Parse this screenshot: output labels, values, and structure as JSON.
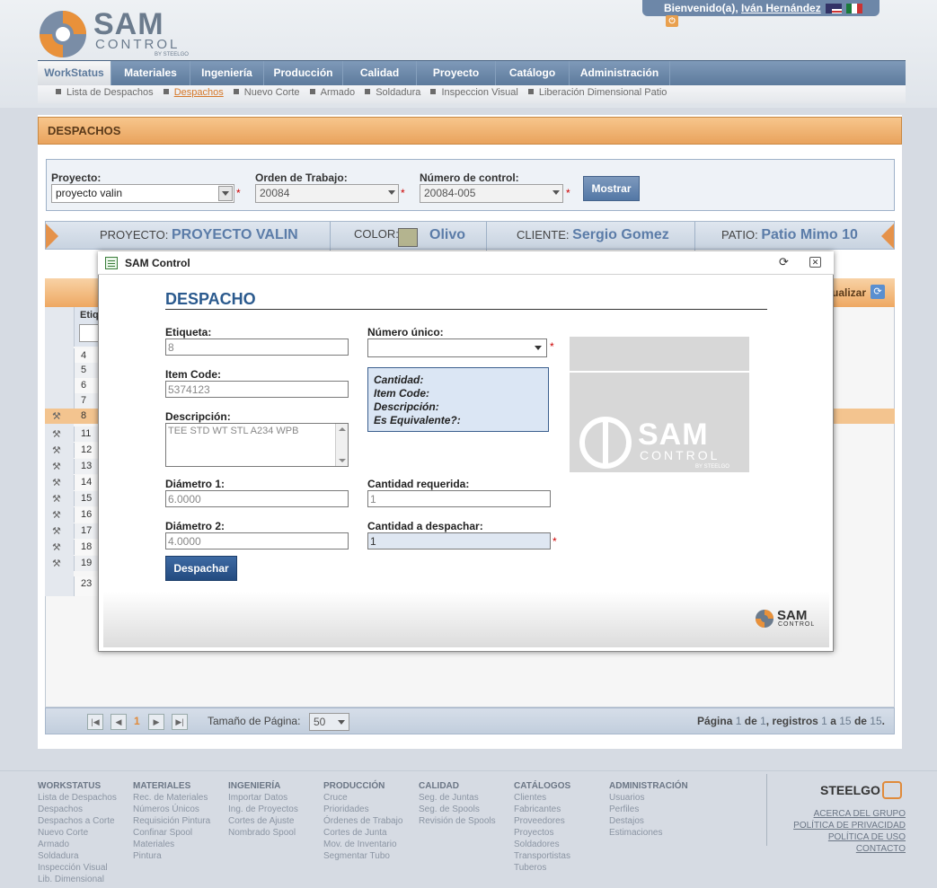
{
  "welcome": {
    "prefix": "Bienvenido(a),",
    "user": "Iván Hernández"
  },
  "logo": {
    "word": "SAM",
    "sub": "CONTROL",
    "by": "BY STEELGO"
  },
  "nav": [
    "WorkStatus",
    "Materiales",
    "Ingeniería",
    "Producción",
    "Calidad",
    "Proyecto",
    "Catálogo",
    "Administración"
  ],
  "subnav": [
    "Lista de Despachos",
    "Despachos",
    "Nuevo Corte",
    "Armado",
    "Soldadura",
    "Inspeccion Visual",
    "Liberación Dimensional Patio"
  ],
  "page_title": "DESPACHOS",
  "filter": {
    "proyecto_label": "Proyecto:",
    "proyecto_value": "proyecto valin",
    "orden_label": "Orden de Trabajo:",
    "orden_value": "20084",
    "numero_label": "Número de control:",
    "numero_value": "20084-005",
    "mostrar": "Mostrar"
  },
  "info": {
    "proyecto_label": "PROYECTO:",
    "proyecto_value": "PROYECTO VALIN",
    "color_label": "COLOR:",
    "color_value": "Olivo",
    "color_swatch": "#b4b48f",
    "cliente_label": "CLIENTE:",
    "cliente_value": "Sergio Gomez",
    "patio_label": "PATIO:",
    "patio_value": "Patio Mimo 10"
  },
  "grid": {
    "head_label": "Etiqu",
    "actualizar": "ualizar",
    "rows": [
      "4",
      "5",
      "6",
      "7",
      "8",
      "11",
      "12",
      "13",
      "14",
      "15",
      "16",
      "17",
      "18",
      "19",
      "23"
    ]
  },
  "pager": {
    "page": "1",
    "size_label": "Tamaño de Página:",
    "size_value": "50",
    "summary_a": "Página",
    "summary_b": "1",
    "summary_c": "de",
    "summary_d": "1",
    "summary_e": ", registros",
    "summary_f": "1",
    "summary_g": "a",
    "summary_h": "15",
    "summary_i": "de",
    "summary_j": "15",
    "summary_k": "."
  },
  "modal": {
    "window_title": "SAM Control",
    "heading": "DESPACHO",
    "etiqueta_label": "Etiqueta:",
    "etiqueta_value": "8",
    "item_code_label": "Item Code:",
    "item_code_value": "5374123",
    "descripcion_label": "Descripción:",
    "descripcion_value": "TEE STD WT STL A234 WPB",
    "diametro1_label": "Diámetro 1:",
    "diametro1_value": "6.0000",
    "diametro2_label": "Diámetro 2:",
    "diametro2_value": "4.0000",
    "numero_unico_label": "Número único:",
    "numero_unico_value": "",
    "info_lines": [
      "Cantidad:",
      "Item Code:",
      "Descripción:",
      "Es Equivalente?:"
    ],
    "cant_req_label": "Cantidad requerida:",
    "cant_req_value": "1",
    "cant_desp_label": "Cantidad a despachar:",
    "cant_desp_value": "1",
    "despachar": "Despachar"
  },
  "footer": {
    "cols": [
      {
        "title": "WORKSTATUS",
        "items": [
          "Lista de Despachos",
          "Despachos",
          "Despachos a Corte",
          "Nuevo Corte",
          "Armado",
          "Soldadura",
          "Inspección Visual",
          "Lib. Dimensional"
        ]
      },
      {
        "title": "MATERIALES",
        "items": [
          "Rec. de Materiales",
          "Números Únicos",
          "Requisición Pintura",
          "Confinar Spool",
          "Materiales",
          "Pintura"
        ]
      },
      {
        "title": "INGENIERÍA",
        "items": [
          "Importar Datos",
          "Ing. de Proyectos",
          "Cortes de Ajuste",
          "Nombrado Spool"
        ]
      },
      {
        "title": "PRODUCCIÓN",
        "items": [
          "Cruce",
          "Prioridades",
          "Órdenes de Trabajo",
          "Cortes de Junta",
          "Mov. de Inventario",
          "Segmentar Tubo"
        ]
      },
      {
        "title": "CALIDAD",
        "items": [
          "Seg. de Juntas",
          "Seg. de Spools",
          "Revisión de Spools"
        ]
      },
      {
        "title": "CATÁLOGOS",
        "items": [
          "Clientes",
          "Fabricantes",
          "Proveedores",
          "Proyectos",
          "Soldadores",
          "Transportistas",
          "Tuberos"
        ]
      },
      {
        "title": "ADMINISTRACIÓN",
        "items": [
          "Usuarios",
          "Perfiles",
          "Destajos",
          "Estimaciones"
        ]
      }
    ],
    "brand": "STEELGO",
    "links": [
      "ACERCA DEL GRUPO",
      "POLÍTICA DE PRIVACIDAD",
      "POLÍTICA DE USO",
      "CONTACTO"
    ]
  }
}
